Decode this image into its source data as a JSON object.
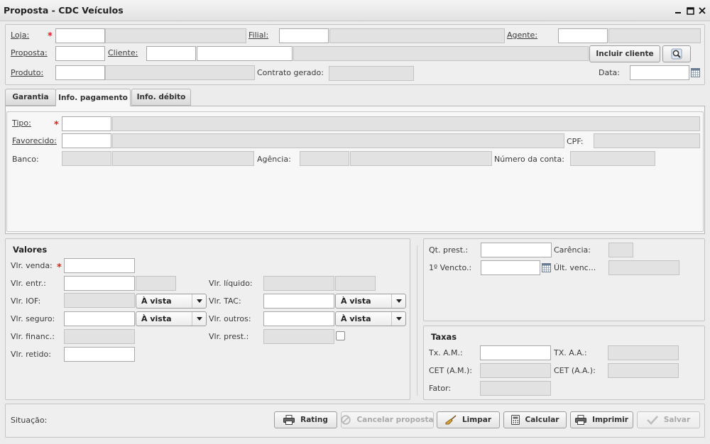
{
  "window": {
    "title": "Proposta - CDC Veículos"
  },
  "header": {
    "loja_label": "Loja:",
    "filial_label": "Filial:",
    "agente_label": "Agente:",
    "proposta_label": "Proposta:",
    "cliente_label": "Cliente:",
    "incluir_cliente_label": "Incluir cliente",
    "produto_label": "Produto:",
    "contrato_gerado_label": "Contrato gerado:",
    "data_label": "Data:"
  },
  "tabs": [
    {
      "label": "Garantia"
    },
    {
      "label": "Info. pagamento"
    },
    {
      "label": "Info. débito"
    }
  ],
  "pagamento": {
    "tipo_label": "Tipo:",
    "favorecido_label": "Favorecido:",
    "cpf_label": "CPF:",
    "banco_label": "Banco:",
    "agencia_label": "Agência:",
    "numero_conta_label": "Número da conta:"
  },
  "valores": {
    "title": "Valores",
    "vlr_venda_label": "Vlr. venda:",
    "vlr_entr_label": "Vlr. entr.:",
    "vlr_iof_label": "Vlr. IOF:",
    "vlr_seguro_label": "Vlr. seguro:",
    "vlr_financ_label": "Vlr. financ.:",
    "vlr_retido_label": "Vlr. retido:",
    "vlr_liquido_label": "Vlr. líquido:",
    "vlr_tac_label": "Vlr. TAC:",
    "vlr_outros_label": "Vlr. outros:",
    "vlr_prest_label": "Vlr. prest.:",
    "iof_select": "À vista",
    "seguro_select": "À vista",
    "tac_select": "À vista",
    "outros_select": "À vista"
  },
  "prestacoes": {
    "qt_prest_label": "Qt. prest.:",
    "carencia_label": "Carência:",
    "primeiro_vencto_label": "1º Vencto.:",
    "ult_venc_label": "Últ. venc..."
  },
  "taxas": {
    "title": "Taxas",
    "tx_am_label": "Tx. A.M.:",
    "tx_aa_label": "TX. A.A.:",
    "cet_am_label": "CET (A.M.):",
    "cet_aa_label": "CET (A.A.):",
    "fator_label": "Fator:"
  },
  "footer": {
    "situacao_label": "Situação:",
    "rating_label": "Rating",
    "cancelar_label": "Cancelar proposta",
    "limpar_label": "Limpar",
    "calcular_label": "Calcular",
    "imprimir_label": "Imprimir",
    "salvar_label": "Salvar"
  },
  "colors": {
    "required": "#dd2222",
    "readonly_bg": "#e2e2e2",
    "panel_bg": "#efefef"
  }
}
